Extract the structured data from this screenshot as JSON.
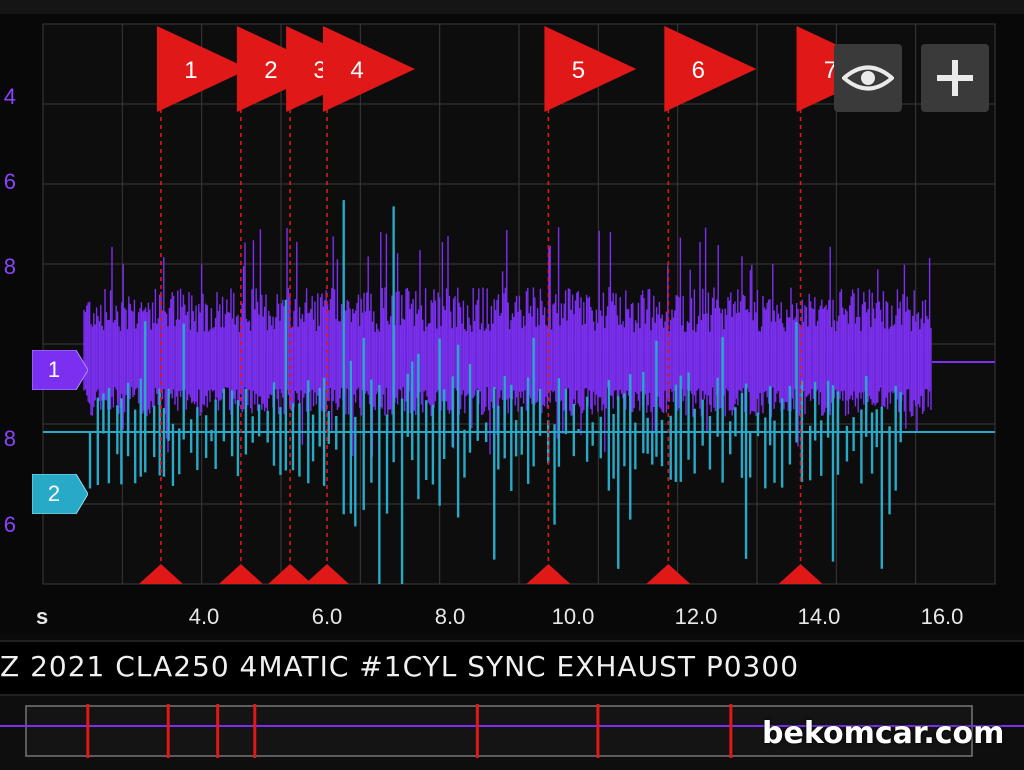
{
  "y_axis": {
    "tick_labels": [
      "4",
      "6",
      "8",
      "8",
      "6"
    ]
  },
  "x_axis": {
    "unit": "s",
    "tick_labels": [
      "4.0",
      "6.0",
      "8.0",
      "10.0",
      "12.0",
      "14.0",
      "16.0"
    ],
    "values": [
      4,
      6,
      8,
      10,
      12,
      14,
      16
    ]
  },
  "markers": [
    {
      "label": "1",
      "t": 3.3
    },
    {
      "label": "2",
      "t": 4.6
    },
    {
      "label": "3",
      "t": 5.4
    },
    {
      "label": "4",
      "t": 6.0
    },
    {
      "label": "5",
      "t": 9.6
    },
    {
      "label": "6",
      "t": 11.55
    },
    {
      "label": "7",
      "t": 13.7
    }
  ],
  "channels": [
    {
      "label": "1",
      "color": "#7b2ff0"
    },
    {
      "label": "2",
      "color": "#27aac8"
    }
  ],
  "toolbar": {
    "view_icon": "eye-icon",
    "add_icon": "plus-icon"
  },
  "title": "Z 2021 CLA250 4MATIC #1CYL SYNC EXHAUST P0300",
  "watermark": "bekomcar.com",
  "colors": {
    "marker": "#e01818",
    "channel1": "#7b2ff0",
    "channel2": "#27aac8",
    "grid": "#3a3a3a"
  }
}
